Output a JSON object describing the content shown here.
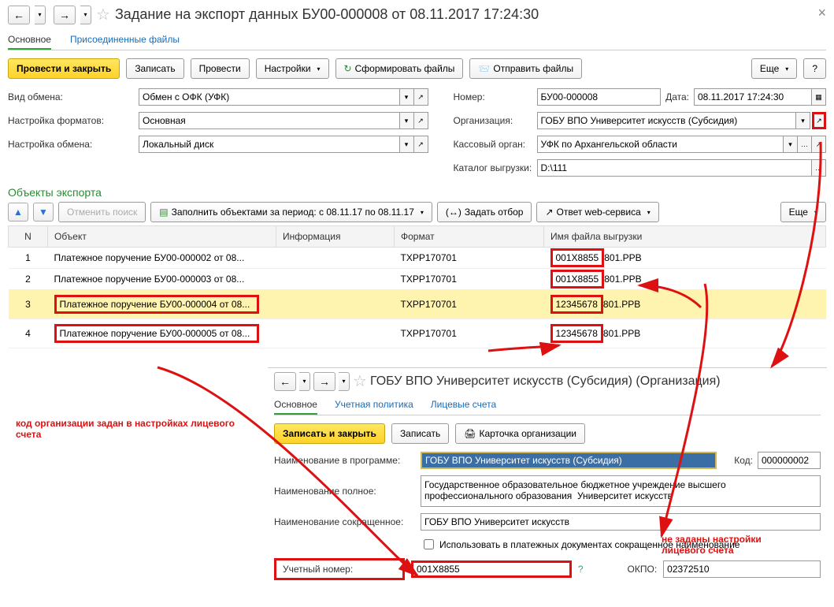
{
  "header": {
    "title": "Задание на экспорт данных БУ00-000008 от 08.11.2017 17:24:30"
  },
  "tabs": {
    "main": "Основное",
    "files": "Присоединенные файлы"
  },
  "toolbar": {
    "post_close": "Провести и закрыть",
    "save": "Записать",
    "post": "Провести",
    "settings": "Настройки",
    "form_files": "Сформировать файлы",
    "send_files": "Отправить файлы",
    "more": "Еще"
  },
  "form": {
    "exchange_type_lbl": "Вид обмена:",
    "exchange_type": "Обмен с ОФК (УФК)",
    "number_lbl": "Номер:",
    "number": "БУ00-000008",
    "date_lbl": "Дата:",
    "date": "08.11.2017 17:24:30",
    "fmt_lbl": "Настройка форматов:",
    "fmt": "Основная",
    "org_lbl": "Организация:",
    "org": "ГОБУ ВПО Университет искусств (Субсидия)",
    "exch_set_lbl": "Настройка обмена:",
    "exch_set": "Локальный диск",
    "kass_lbl": "Кассовый орган:",
    "kass": "УФК по Архангельской области",
    "catalog_lbl": "Каталог выгрузки:",
    "catalog": "D:\\111"
  },
  "objects": {
    "title": "Объекты экспорта",
    "cancel_search": "Отменить поиск",
    "fill_period": "Заполнить объектами за период: с 08.11.17 по 08.11.17",
    "set_filter": "Задать отбор",
    "web_answer": "Ответ web-сервиса",
    "more": "Еще",
    "cols": {
      "n": "N",
      "obj": "Объект",
      "info": "Информация",
      "fmt": "Формат",
      "fname": "Имя файла выгрузки"
    },
    "rows": [
      {
        "n": "1",
        "obj": "Платежное поручение БУ00-000002 от 08...",
        "fmt": "TXPP170701",
        "fname": "001X8855801.PPB"
      },
      {
        "n": "2",
        "obj": "Платежное поручение БУ00-000003 от 08...",
        "fmt": "TXPP170701",
        "fname": "001X8855801.PPB"
      },
      {
        "n": "3",
        "obj": "Платежное поручение БУ00-000004 от 08...",
        "fmt": "TXPP170701",
        "fname": "12345678801.PPB"
      },
      {
        "n": "4",
        "obj": "Платежное поручение БУ00-000005 от 08...",
        "fmt": "TXPP170701",
        "fname": "12345678801.PPB"
      }
    ]
  },
  "annot": {
    "left": "код организации задан в настройках лицевого счета",
    "right": "не заданы настройки лицевого счета"
  },
  "sub": {
    "title": "ГОБУ ВПО Университет искусств (Субсидия) (Организация)",
    "tabs": {
      "main": "Основное",
      "policy": "Учетная политика",
      "accounts": "Лицевые счета"
    },
    "btn_save_close": "Записать и закрыть",
    "btn_save": "Записать",
    "btn_card": "Карточка организации",
    "name_prog_lbl": "Наименование в программе:",
    "name_prog": "ГОБУ ВПО Университет искусств (Субсидия)",
    "code_lbl": "Код:",
    "code": "000000002",
    "name_full_lbl": "Наименование полное:",
    "name_full": "Государственное образовательное бюджетное учреждение высшего профессионального образования  Университет искусств",
    "name_short_lbl": "Наименование сокращенное:",
    "name_short": "ГОБУ ВПО Университет искусств",
    "chk": "Использовать в платежных документах сокращенное наименование",
    "acct_lbl": "Учетный номер:",
    "acct": "001X8855",
    "okpo_lbl": "ОКПО:",
    "okpo": "02372510"
  }
}
